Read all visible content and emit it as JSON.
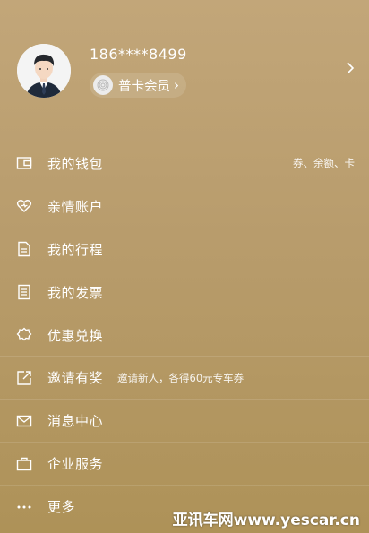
{
  "profile": {
    "phone": "186****8499",
    "member_badge": "普卡会员",
    "badge_arrow": "›"
  },
  "menu": [
    {
      "label": "我的钱包",
      "icon": "wallet-icon",
      "hint": "券、余额、卡"
    },
    {
      "label": "亲情账户",
      "icon": "heart-icon"
    },
    {
      "label": "我的行程",
      "icon": "trip-document-icon"
    },
    {
      "label": "我的发票",
      "icon": "invoice-icon"
    },
    {
      "label": "优惠兑换",
      "icon": "coupon-gear-icon"
    },
    {
      "label": "邀请有奖",
      "icon": "share-icon",
      "hint": "邀请新人，各得60元专车券"
    },
    {
      "label": "消息中心",
      "icon": "mail-icon"
    },
    {
      "label": "企业服务",
      "icon": "briefcase-icon"
    },
    {
      "label": "更多",
      "icon": "more-dots-icon"
    }
  ],
  "watermark": "亚讯车网www.yescar.cn"
}
